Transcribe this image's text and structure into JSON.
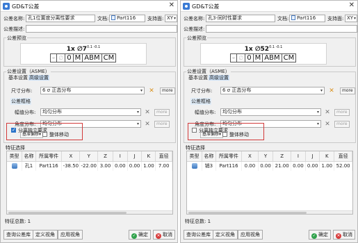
{
  "dialogs": [
    {
      "title": "GD&T公差",
      "name_label": "公差名称:",
      "name_value": "孔1位置度分离性要求",
      "doc_label": "文档:",
      "doc_value": "Part116",
      "support_label": "支持面:",
      "support_value": "XY",
      "desc_label": "公差描述:",
      "desc_value": "",
      "preview_group": "公差预览",
      "preview_top": "1x ∅7",
      "preview_top_sup": "0.1 -0.1",
      "preview_frame": [
        "⌖",
        "∅",
        "0",
        "M",
        "ABM",
        "CM"
      ],
      "settings_group": "公差设置（ASME）",
      "tab_basic": "基本设置",
      "tab_advanced": "高级设置",
      "size_dist_label": "尺寸分布:",
      "size_dist_value": "6 σ 正态分布",
      "tol_frame_title": "公差框格",
      "amp_label": "幅值分布:",
      "amp_value": "均匀分布",
      "angle_label": "角度分布:",
      "angle_value": "均匀分布",
      "more_btn": "more",
      "datum_shift_btn": "基准偏移▾",
      "whole_move_label": "整体移动",
      "whole_move_checked": false,
      "separate_label": "分离独立要求",
      "separate_checked": true,
      "feature_group": "特征选择",
      "table_headers": [
        "类型",
        "名称",
        "所属零件",
        "X",
        "Y",
        "Z",
        "I",
        "J",
        "K",
        "直径"
      ],
      "table_rows": [
        [
          "",
          "孔1",
          "Part116",
          "-38.50",
          "-22.00",
          "3.00",
          "0.00",
          "0.00",
          "1.00",
          "7.00"
        ]
      ],
      "feature_count": "特征总数: 1",
      "btn_query": "查询公差库",
      "btn_define_view": "定义视角",
      "btn_apply_view": "应用视角",
      "btn_ok": "确定",
      "btn_cancel": "取消"
    },
    {
      "title": "GD&T公差",
      "name_label": "公差名称:",
      "name_value": "孔3-同时性要求",
      "doc_label": "文档:",
      "doc_value": "Part116",
      "support_label": "支持面:",
      "support_value": "XY",
      "desc_label": "公差描述:",
      "desc_value": "",
      "preview_group": "公差预览",
      "preview_top": "1x ∅52",
      "preview_top_sup": "0.1 -0.1",
      "preview_frame": [
        "⌖",
        "∅",
        "0",
        "M",
        "ABM",
        "CM"
      ],
      "settings_group": "公差设置（ASME）",
      "tab_basic": "基本设置",
      "tab_advanced": "高级设置",
      "size_dist_label": "尺寸分布:",
      "size_dist_value": "6 σ 正态分布",
      "tol_frame_title": "公差框格",
      "amp_label": "幅值分布:",
      "amp_value": "均匀分布",
      "angle_label": "角度分布:",
      "angle_value": "均匀分布",
      "more_btn": "more",
      "datum_shift_btn": "基准偏移▾",
      "whole_move_label": "整体移动",
      "whole_move_checked": false,
      "separate_label": "分离独立要求",
      "separate_checked": false,
      "feature_group": "特征选择",
      "table_headers": [
        "类型",
        "名称",
        "所属零件",
        "X",
        "Y",
        "Z",
        "I",
        "J",
        "K",
        "直径"
      ],
      "table_rows": [
        [
          "",
          "销3",
          "Part116",
          "0.00",
          "0.00",
          "21.00",
          "0.00",
          "0.00",
          "1.00",
          "52.00"
        ]
      ],
      "feature_count": "特征总数: 1",
      "btn_query": "查询公差库",
      "btn_define_view": "定义视角",
      "btn_apply_view": "应用视角",
      "btn_ok": "确定",
      "btn_cancel": "取消"
    }
  ]
}
